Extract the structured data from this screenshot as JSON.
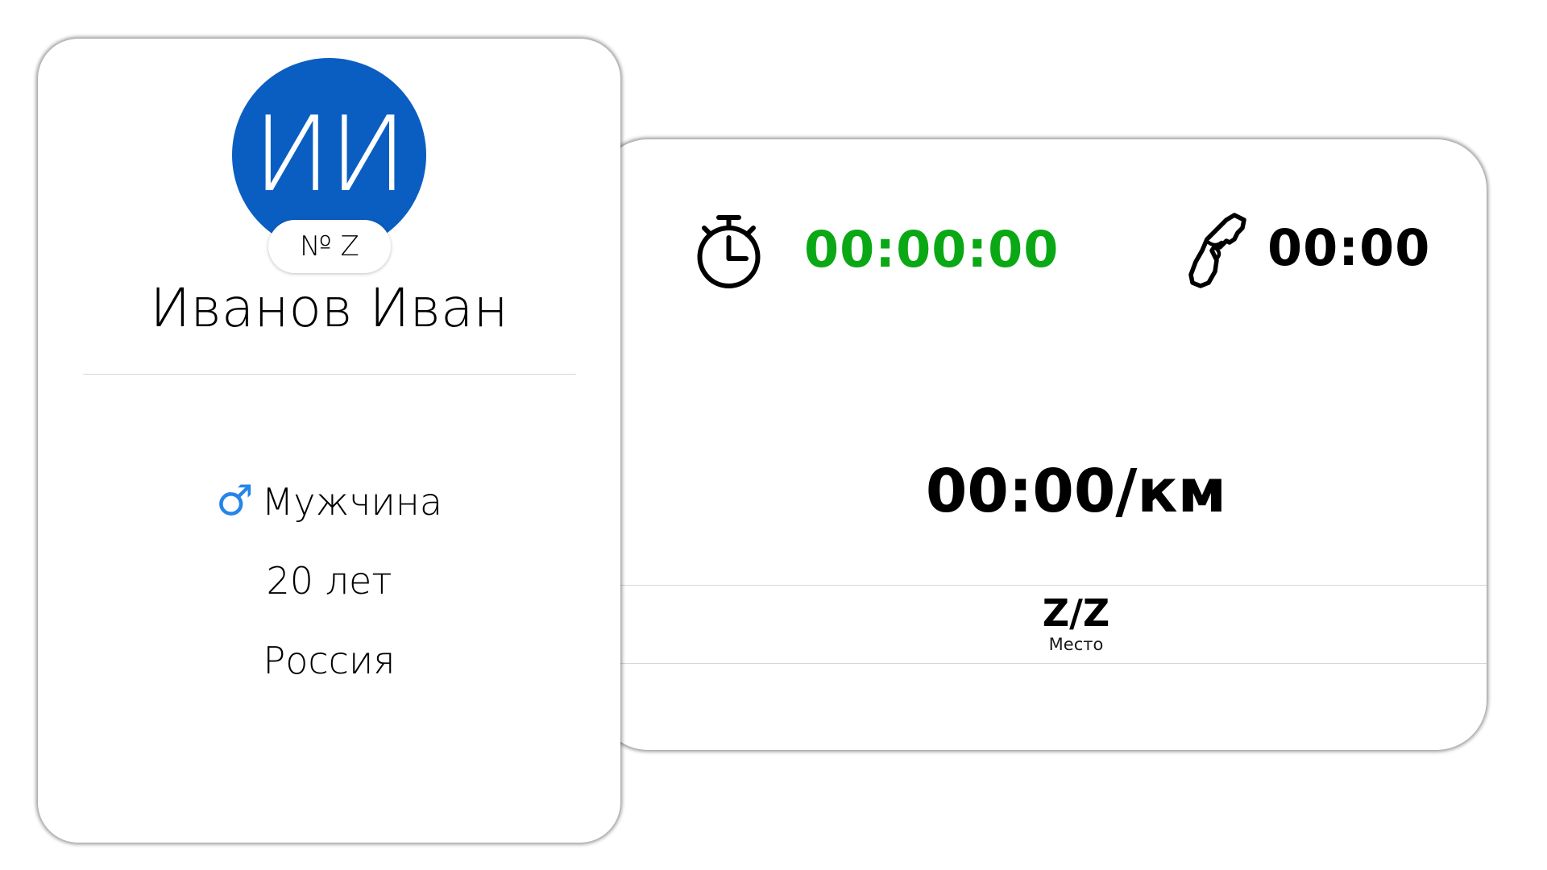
{
  "profile": {
    "initials": "ИИ",
    "bib": "№ Z",
    "name": "Иванов Иван",
    "gender_icon": "♂",
    "gender": "Мужчина",
    "age": "20 лет",
    "country": "Россия",
    "avatar_color": "#0b5ec1",
    "gender_icon_color": "#2784e8"
  },
  "stats": {
    "stopwatch_icon": "stopwatch-icon",
    "elapsed_time": "00:00:00",
    "elapsed_time_color": "#0aa815",
    "start_gun_icon": "start-gun-icon",
    "gun_time": "00:00",
    "pace": "00:00/км",
    "place_value": "Z/Z",
    "place_label": "Место"
  }
}
